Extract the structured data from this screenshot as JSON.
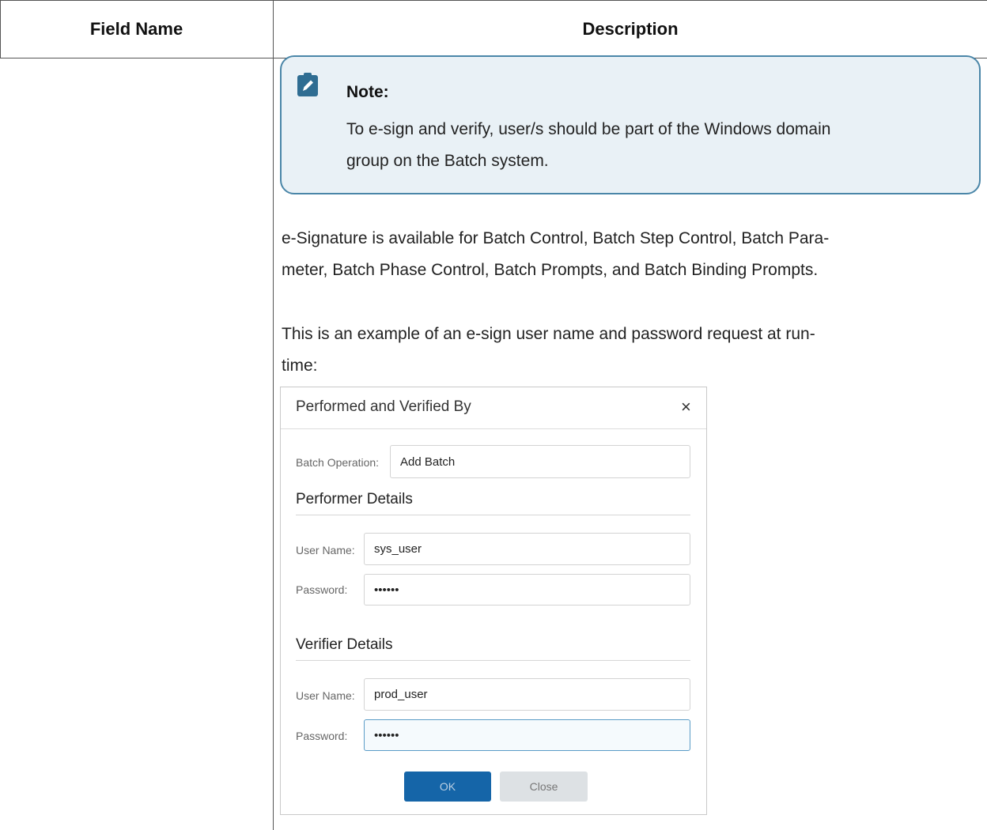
{
  "table": {
    "headers": [
      "Field Name",
      "Description"
    ]
  },
  "note": {
    "icon": "pencil-note-icon",
    "title": "Note:",
    "lines": [
      "To e-sign and verify, user/s should be part of the Windows domain",
      "group on the Batch system."
    ]
  },
  "paragraphs": [
    {
      "lines": [
        "e-Signature is available for Batch Control, Batch Step Control, Batch Para-",
        "meter, Batch Phase Control, Batch Prompts, and Batch Binding Prompts."
      ]
    },
    {
      "lines": [
        "This is an example of an e-sign user name and password request at run-",
        "time:"
      ]
    }
  ],
  "dialog": {
    "title": "Performed and Verified By",
    "close_glyph": "×",
    "batch_operation": {
      "label": "Batch Operation:",
      "value": "Add Batch"
    },
    "performer": {
      "heading": "Performer Details",
      "username_label": "User Name:",
      "username": "sys_user",
      "password_label": "Password:",
      "password": "••••••"
    },
    "verifier": {
      "heading": "Verifier Details",
      "username_label": "User Name:",
      "username": "prod_user",
      "password_label": "Password:",
      "password": "••••••"
    },
    "ok_label": "OK",
    "close_label": "Close"
  },
  "colors": {
    "note_background": "#e9f1f6",
    "note_border": "#4a86a8",
    "ok_button": "#1565a8",
    "close_button": "#dde1e4"
  }
}
